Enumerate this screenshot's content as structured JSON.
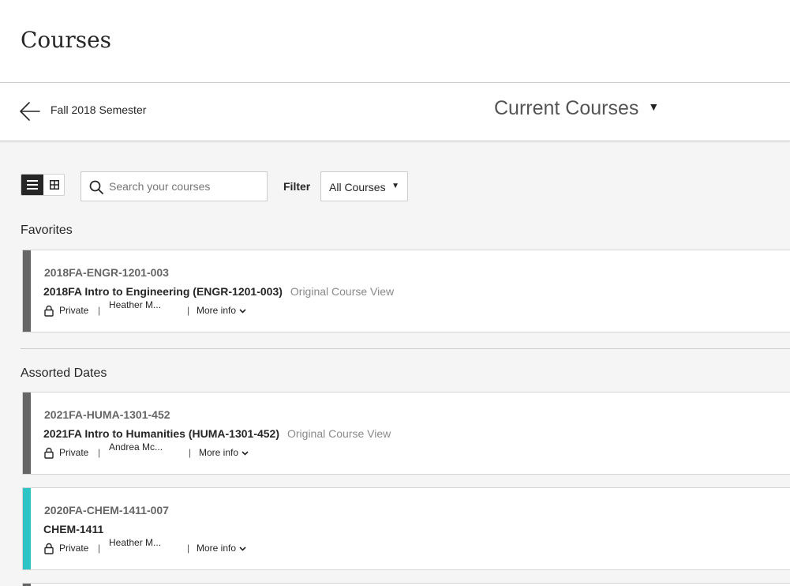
{
  "header": {
    "title": "Courses"
  },
  "subnav": {
    "term_label": "Fall 2018 Semester",
    "view_label": "Current Courses"
  },
  "toolbar": {
    "search_placeholder": "Search your courses",
    "filter_label": "Filter",
    "filter_value": "All Courses"
  },
  "sections": [
    {
      "title": "Favorites",
      "courses": [
        {
          "id": "2018FA-ENGR-1201-003",
          "name": "2018FA Intro to Engineering (ENGR-1201-003)",
          "view": "Original Course View",
          "privacy": "Private",
          "instructor": "Heather M...",
          "more_info": "More info",
          "color": "#666666"
        }
      ]
    },
    {
      "title": "Assorted Dates",
      "courses": [
        {
          "id": "2021FA-HUMA-1301-452",
          "name": "2021FA Intro to Humanities (HUMA-1301-452)",
          "view": "Original Course View",
          "privacy": "Private",
          "instructor": "Andrea Mc...",
          "more_info": "More info",
          "color": "#666666"
        },
        {
          "id": "2020FA-CHEM-1411-007",
          "name": "CHEM-1411",
          "view": "",
          "privacy": "Private",
          "instructor": "Heather M...",
          "more_info": "More info",
          "color": "#2ec4c6"
        }
      ]
    }
  ]
}
